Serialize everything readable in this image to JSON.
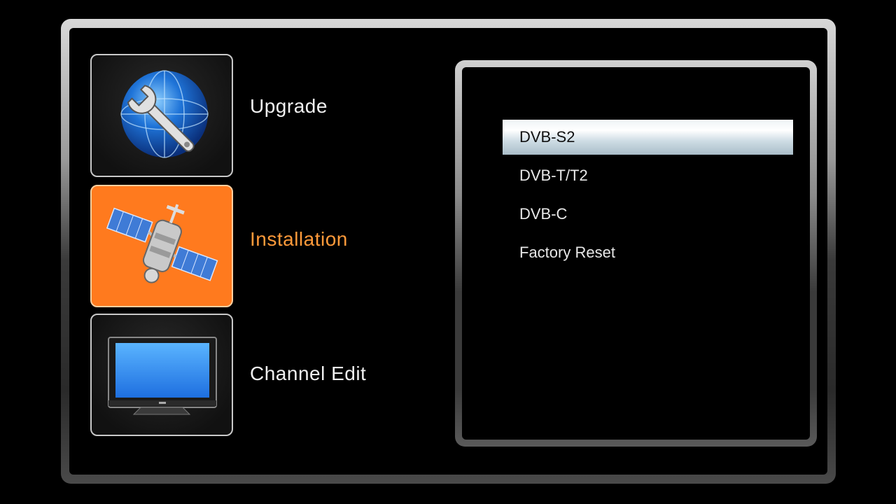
{
  "main_menu": {
    "items": [
      {
        "label": "Upgrade",
        "icon": "globe-wrench-icon",
        "selected": false
      },
      {
        "label": "Installation",
        "icon": "satellite-icon",
        "selected": true
      },
      {
        "label": "Channel Edit",
        "icon": "tv-icon",
        "selected": false
      }
    ]
  },
  "submenu": {
    "items": [
      {
        "label": "DVB-S2",
        "selected": true
      },
      {
        "label": "DVB-T/T2",
        "selected": false
      },
      {
        "label": "DVB-C",
        "selected": false
      },
      {
        "label": "Factory Reset",
        "selected": false
      }
    ]
  },
  "colors": {
    "active_label": "#ff9a3a",
    "active_tile": "#ff7a1e",
    "text": "#f0f0f0"
  }
}
